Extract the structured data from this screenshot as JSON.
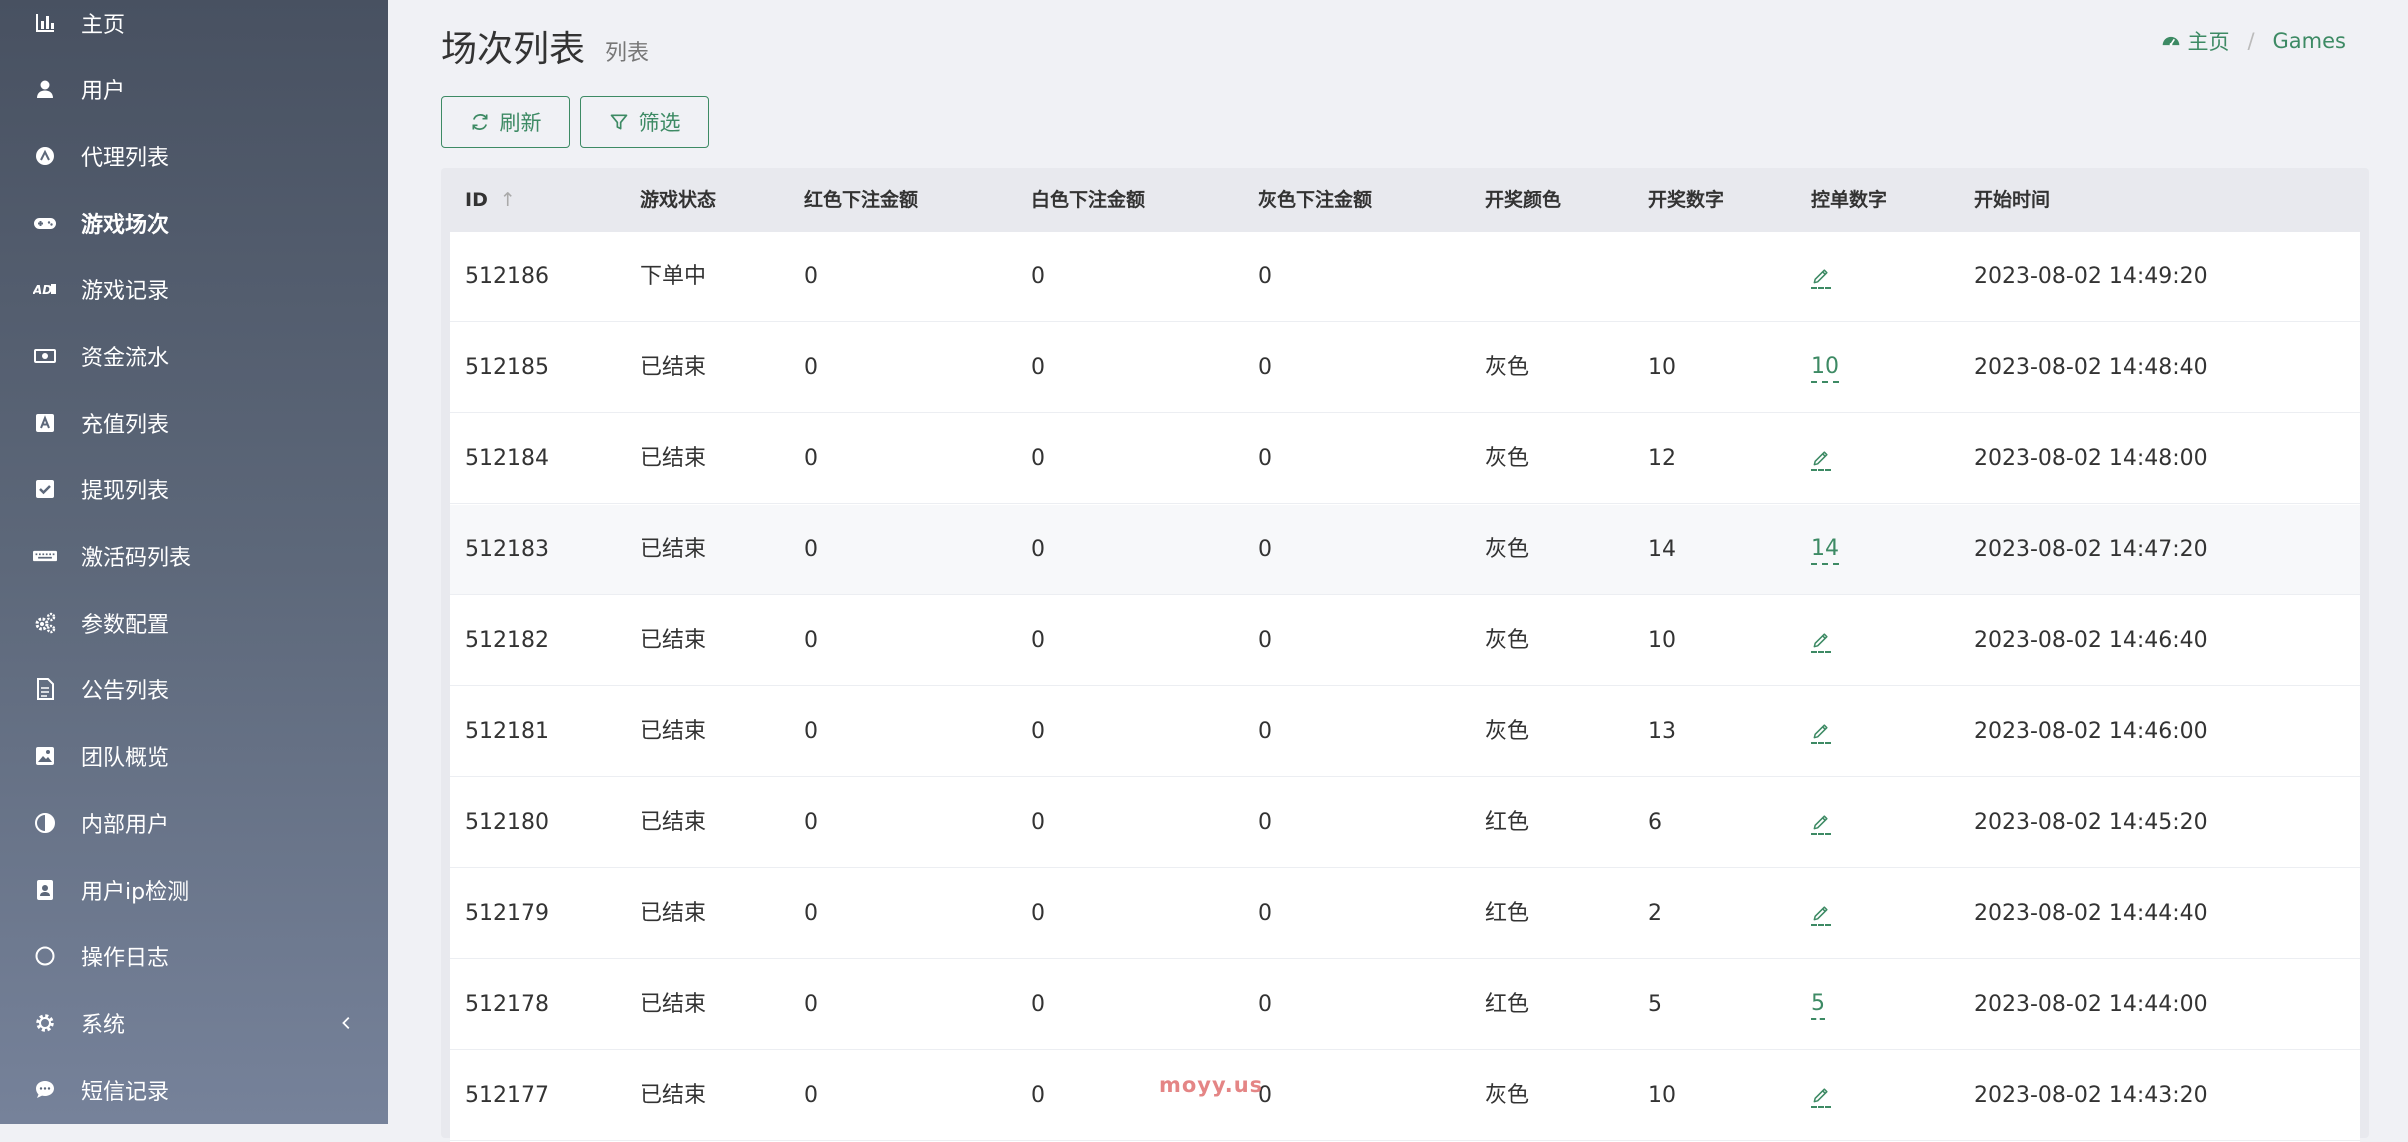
{
  "sidebar": {
    "items": [
      {
        "label": "主页",
        "icon": "bar-chart-icon"
      },
      {
        "label": "用户",
        "icon": "user-icon"
      },
      {
        "label": "代理列表",
        "icon": "agent-circle-icon"
      },
      {
        "label": "游戏场次",
        "icon": "gamepad-icon",
        "active": true
      },
      {
        "label": "游戏记录",
        "icon": "ad-icon"
      },
      {
        "label": "资金流水",
        "icon": "money-bill-icon"
      },
      {
        "label": "充值列表",
        "icon": "font-a-icon"
      },
      {
        "label": "提现列表",
        "icon": "check-square-icon"
      },
      {
        "label": "激活码列表",
        "icon": "keyboard-icon"
      },
      {
        "label": "参数配置",
        "icon": "cogs-icon"
      },
      {
        "label": "公告列表",
        "icon": "file-text-icon"
      },
      {
        "label": "团队概览",
        "icon": "image-icon"
      },
      {
        "label": "内部用户",
        "icon": "adjust-icon"
      },
      {
        "label": "用户ip检测",
        "icon": "address-book-icon"
      },
      {
        "label": "操作日志",
        "icon": "circle-icon"
      },
      {
        "label": "系统",
        "icon": "gear-icon",
        "has_children": true
      },
      {
        "label": "短信记录",
        "icon": "comment-icon"
      }
    ]
  },
  "header": {
    "title": "场次列表",
    "subtitle": "列表",
    "breadcrumb": {
      "home": "主页",
      "current": "Games"
    }
  },
  "toolbar": {
    "refresh_label": "刷新",
    "filter_label": "筛选"
  },
  "table": {
    "columns": [
      "ID",
      "游戏状态",
      "红色下注金额",
      "白色下注金额",
      "灰色下注金额",
      "开奖颜色",
      "开奖数字",
      "控单数字",
      "开始时间"
    ],
    "rows": [
      {
        "id": "512186",
        "status": "下单中",
        "red": "0",
        "white": "0",
        "gray": "0",
        "color": "",
        "number": "",
        "control": "",
        "time": "2023-08-02 14:49:20"
      },
      {
        "id": "512185",
        "status": "已结束",
        "red": "0",
        "white": "0",
        "gray": "0",
        "color": "灰色",
        "number": "10",
        "control": "10",
        "time": "2023-08-02 14:48:40"
      },
      {
        "id": "512184",
        "status": "已结束",
        "red": "0",
        "white": "0",
        "gray": "0",
        "color": "灰色",
        "number": "12",
        "control": "",
        "time": "2023-08-02 14:48:00"
      },
      {
        "id": "512183",
        "status": "已结束",
        "red": "0",
        "white": "0",
        "gray": "0",
        "color": "灰色",
        "number": "14",
        "control": "14",
        "time": "2023-08-02 14:47:20"
      },
      {
        "id": "512182",
        "status": "已结束",
        "red": "0",
        "white": "0",
        "gray": "0",
        "color": "灰色",
        "number": "10",
        "control": "",
        "time": "2023-08-02 14:46:40"
      },
      {
        "id": "512181",
        "status": "已结束",
        "red": "0",
        "white": "0",
        "gray": "0",
        "color": "灰色",
        "number": "13",
        "control": "",
        "time": "2023-08-02 14:46:00"
      },
      {
        "id": "512180",
        "status": "已结束",
        "red": "0",
        "white": "0",
        "gray": "0",
        "color": "红色",
        "number": "6",
        "control": "",
        "time": "2023-08-02 14:45:20"
      },
      {
        "id": "512179",
        "status": "已结束",
        "red": "0",
        "white": "0",
        "gray": "0",
        "color": "红色",
        "number": "2",
        "control": "",
        "time": "2023-08-02 14:44:40"
      },
      {
        "id": "512178",
        "status": "已结束",
        "red": "0",
        "white": "0",
        "gray": "0",
        "color": "红色",
        "number": "5",
        "control": "5",
        "time": "2023-08-02 14:44:00"
      },
      {
        "id": "512177",
        "status": "已结束",
        "red": "0",
        "white": "0",
        "gray": "0",
        "color": "灰色",
        "number": "10",
        "control": "",
        "time": "2023-08-02 14:43:20"
      }
    ]
  },
  "watermark": "moyy.us",
  "colors": {
    "accent": "#3d8a64",
    "sidebar_top": "#485161",
    "sidebar_bottom": "#76829a",
    "background": "#f0f1f5"
  }
}
